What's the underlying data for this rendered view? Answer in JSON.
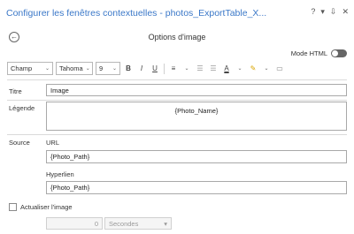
{
  "window": {
    "title": "Configurer les fenêtres contextuelles - photos_ExportTable_X...",
    "controls": {
      "help": "?",
      "menu": "▾",
      "pin": "⇩",
      "close": "✕"
    }
  },
  "panel": {
    "back_icon": "arrow-left-icon",
    "title": "Options d'image",
    "html_mode_label": "Mode HTML"
  },
  "toolbar": {
    "field_dropdown": "Champ",
    "font_dropdown": "Tahoma",
    "size_dropdown": "9",
    "bold": "B",
    "italic": "I",
    "underline": "U",
    "align": "≡",
    "list_bullets": "☰",
    "list_indent": "☰",
    "font_color": "A",
    "highlight": "✎",
    "more": "▭"
  },
  "form": {
    "title_label": "Titre",
    "title_value": "Image",
    "caption_label": "Légende",
    "caption_value": "{Photo_Name}",
    "source_label": "Source",
    "url_label": "URL",
    "url_value": "{Photo_Path}",
    "hyperlink_label": "Hyperlien",
    "hyperlink_value": "{Photo_Path}",
    "refresh_label": "Actualiser l'image",
    "interval_value": "0",
    "interval_unit": "Secondes"
  }
}
